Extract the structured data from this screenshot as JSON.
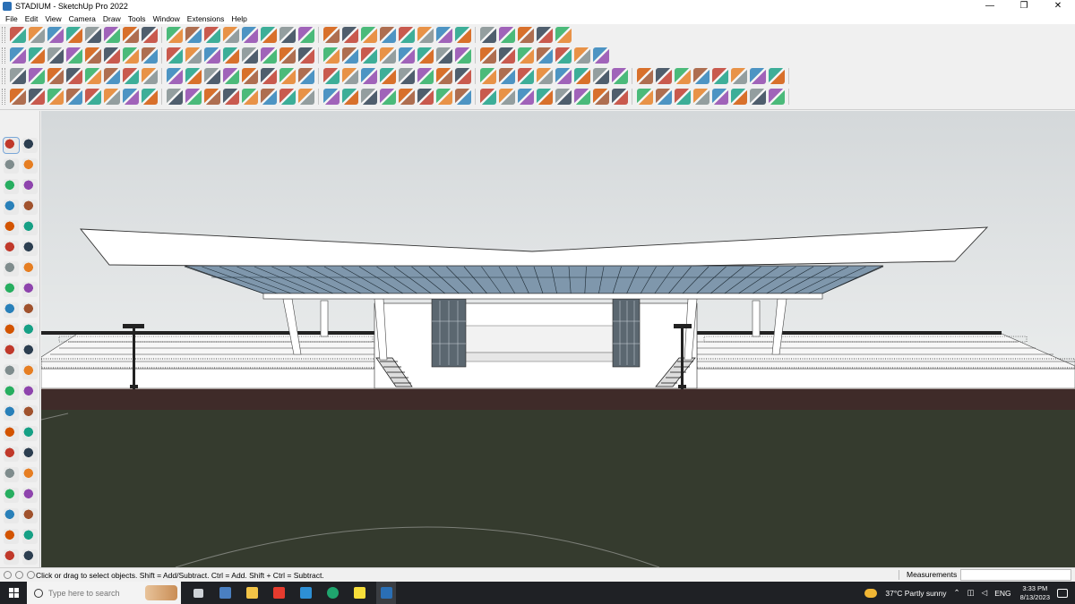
{
  "window": {
    "title": "STADIUM - SketchUp Pro 2022",
    "minimize": "—",
    "maximize": "❐",
    "close": "✕"
  },
  "menu": [
    "File",
    "Edit",
    "View",
    "Camera",
    "Draw",
    "Tools",
    "Window",
    "Extensions",
    "Help"
  ],
  "toolbar_icons": {
    "row1": [
      "zoom-icon",
      "select-icon",
      "eraser-icon",
      "line-icon",
      "arc-icon",
      "paint-bucket-icon",
      "push-pull-icon",
      "move-icon",
      "rotate-icon",
      "scale-icon",
      "tape-measure-icon",
      "text-icon",
      "paint-icon",
      "section-plane-icon",
      "orbit-icon",
      "pan-icon",
      "zoom-extents-icon",
      "components-icon",
      "materials-icon",
      "styles-icon",
      "user-icon",
      "extension-icon",
      "sandbox-icon",
      "flip-icon",
      "align-icon",
      "layer-icon",
      "undo-icon",
      "redo-icon",
      "help-icon"
    ],
    "row2": [
      "cube-icon",
      "box-icon",
      "iso-view-icon",
      "top-view-icon",
      "front-view-icon",
      "right-view-icon",
      "back-view-icon",
      "left-view-icon",
      "bottom-view-icon",
      "curve-icon",
      "extrude-icon",
      "offset-icon",
      "house-icon",
      "warehouse-icon",
      "building-icon",
      "roof-icon",
      "solid-tools-icon",
      "pencil-icon",
      "shape-icon",
      "polygon-icon",
      "circle-icon",
      "hexagon-icon",
      "parallelogram-icon",
      "arc-shape-icon",
      "spiral-icon",
      "lathe-icon",
      "pipe-icon",
      "paint-tag-icon",
      "erase-tag-icon",
      "texture-icon",
      "terrain-icon"
    ],
    "row3": [
      "shape-a-icon",
      "shape-b-icon",
      "shape-c-icon",
      "shape-d-icon",
      "shape-e-icon",
      "shape-f-icon",
      "shape-g-icon",
      "shape-h-icon",
      "shape-i-icon",
      "shape-j-icon",
      "shape-k-icon",
      "shape-l-icon",
      "shape-m-icon",
      "shape-n-icon",
      "shape-o-icon",
      "shape-p-icon",
      "shape-q-icon",
      "shape-r-icon",
      "shape-s-icon",
      "shape-t-icon",
      "shape-u-icon",
      "shape-v-icon",
      "shape-w-icon",
      "shape-x-icon",
      "shape-y-icon",
      "shape-z-icon",
      "shape-aa-icon",
      "shape-ab-icon",
      "shape-ac-icon",
      "shape-ad-icon",
      "shape-ae-icon",
      "shape-af-icon",
      "shape-ag-icon",
      "shape-ah-icon",
      "shape-ai-icon",
      "shape-aj-icon",
      "shape-ak-icon",
      "shape-al-icon",
      "shape-am-icon",
      "shape-an-icon"
    ],
    "row4": [
      "draw-a-icon",
      "draw-b-icon",
      "draw-c-icon",
      "draw-d-icon",
      "draw-e-icon",
      "draw-f-icon",
      "draw-g-icon",
      "draw-h-icon",
      "draw-i-icon",
      "draw-j-icon",
      "draw-k-icon",
      "draw-l-icon",
      "draw-m-icon",
      "draw-n-icon",
      "draw-o-icon",
      "draw-p-icon",
      "draw-q-icon",
      "draw-r-icon",
      "draw-s-icon",
      "draw-t-icon",
      "draw-u-icon",
      "draw-v-icon",
      "draw-w-icon",
      "draw-x-icon",
      "draw-y-icon",
      "draw-z-icon",
      "draw-aa-icon",
      "draw-ab-icon",
      "draw-ac-icon",
      "draw-ad-icon",
      "draw-ae-icon",
      "draw-af-icon",
      "draw-ag-icon",
      "draw-ah-icon",
      "draw-ai-icon",
      "draw-aj-icon",
      "draw-ak-icon",
      "draw-al-icon",
      "draw-am-icon",
      "draw-an-icon"
    ]
  },
  "palette_icons": [
    "select-tool-icon",
    "orbit-tool-icon",
    "paint-tool-icon",
    "eraser-tool-icon",
    "component-tool-icon",
    "tag-tool-icon",
    "line-tool-icon",
    "freehand-tool-icon",
    "rectangle-tool-icon",
    "rotated-rect-tool-icon",
    "circle-tool-icon",
    "polygon-tool-icon",
    "arc-tool-icon",
    "pie-tool-icon",
    "two-point-arc-icon",
    "three-point-arc-icon",
    "push-pull-tool-icon",
    "follow-me-tool-icon",
    "rotate-tool-icon",
    "offset-tool-icon",
    "scale-tool-icon",
    "move-tool-icon",
    "tape-tool-icon",
    "text-tool-icon",
    "protractor-tool-icon",
    "dimension-tool-icon",
    "axes-tool-icon",
    "3d-text-tool-icon",
    "position-camera-icon",
    "look-around-icon",
    "pan-tool-icon",
    "zoom-tool-icon",
    "zoom-window-icon",
    "zoom-extents-tool-icon",
    "walk-tool-icon",
    "eye-tool-icon",
    "footprint-tool-icon",
    "arrow-tool-icon",
    "section-tool-icon",
    "sandbox-tool-icon",
    "smoove-tool-icon",
    "stamp-tool-icon"
  ],
  "status": {
    "hint": "Click or drag to select objects. Shift = Add/Subtract. Ctrl = Add. Shift + Ctrl = Subtract.",
    "measurements_label": "Measurements",
    "measurements_value": ""
  },
  "taskbar": {
    "search_placeholder": "Type here to search",
    "weather": "37°C  Partly sunny",
    "language": "ENG",
    "time": "3:33 PM",
    "date": "8/13/2023"
  },
  "colors": {
    "accent": "#2a6fb5",
    "sky": "#d9dcde",
    "grass": "#353b2e",
    "track": "#3f2b29"
  }
}
